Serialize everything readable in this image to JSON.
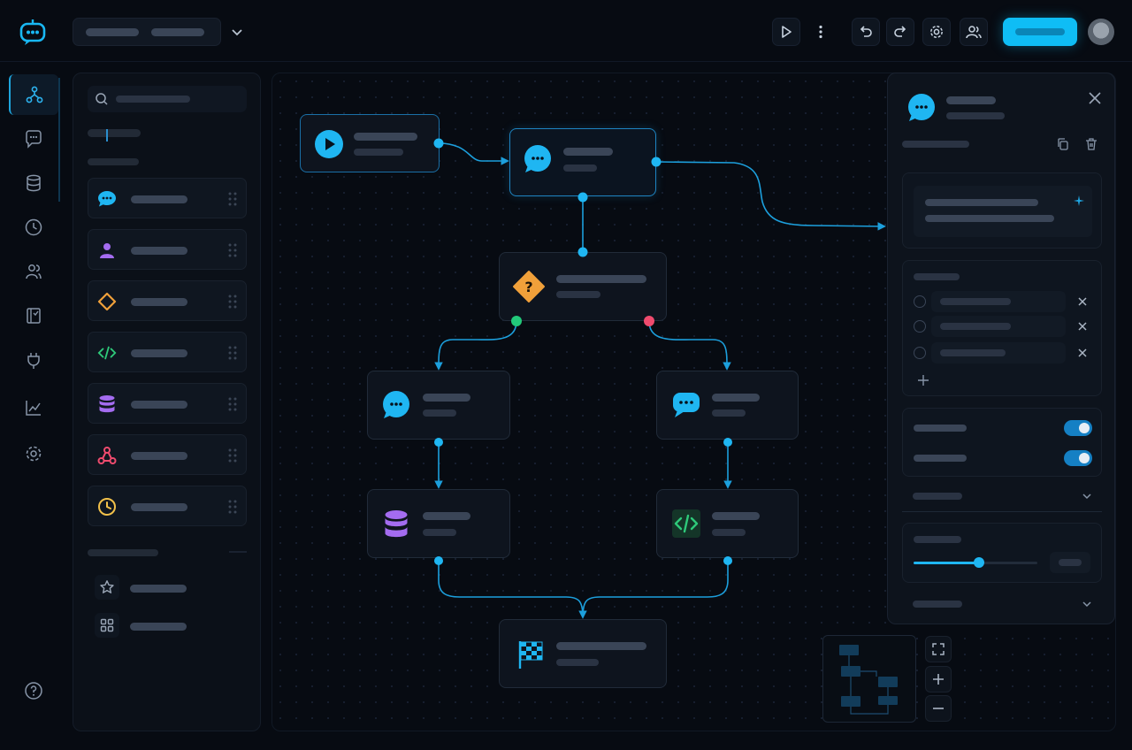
{
  "toolbar": {
    "run_icon": "play-icon",
    "more_icon": "vertical-dots-icon",
    "undo_icon": "undo-icon",
    "redo_icon": "redo-icon",
    "settings_icon": "gear-icon",
    "collaborators_icon": "users-icon",
    "accent": "#0fbdf5"
  },
  "rail": {
    "items": [
      "flow-icon",
      "chat-icon",
      "database-icon",
      "clock-icon",
      "users-icon",
      "book-icon",
      "plug-icon",
      "analytics-icon",
      "gear-icon",
      "help-icon"
    ],
    "active": "flow-icon"
  },
  "palette": {
    "blocks": [
      {
        "icon": "chat-bubble-icon",
        "color": "#1fb6f2"
      },
      {
        "icon": "person-icon",
        "color": "#a46cf0"
      },
      {
        "icon": "diamond-icon",
        "color": "#f0a03a"
      },
      {
        "icon": "code-icon",
        "color": "#2ec97a"
      },
      {
        "icon": "database-icon",
        "color": "#a46cf0"
      },
      {
        "icon": "webhook-icon",
        "color": "#ef4b6e"
      },
      {
        "icon": "clock-icon",
        "color": "#f2c14a"
      }
    ],
    "extras": [
      "star-icon",
      "grid-icon"
    ]
  },
  "canvas": {
    "nodes": [
      {
        "id": "start",
        "icon": "play-icon",
        "color": "#1fb6f2"
      },
      {
        "id": "message",
        "icon": "chat-bubble-icon",
        "color": "#1fb6f2",
        "selected": true
      },
      {
        "id": "condition",
        "icon": "question-diamond-icon",
        "color": "#f0a03a"
      },
      {
        "id": "reply-left",
        "icon": "chat-bubble-icon",
        "color": "#1fb6f2"
      },
      {
        "id": "reply-right",
        "icon": "chat-bubble-icon",
        "color": "#1fb6f2"
      },
      {
        "id": "database",
        "icon": "database-icon",
        "color": "#a46cf0"
      },
      {
        "id": "code",
        "icon": "code-icon",
        "color": "#2ec97a"
      },
      {
        "id": "end",
        "icon": "checkered-flag-icon",
        "color": "#1fb6f2"
      }
    ],
    "branch_true_color": "#22c97a",
    "branch_false_color": "#ef4b6e",
    "edge_color": "#1c9fdc"
  },
  "properties": {
    "header_icon": "chat-bubble-icon",
    "options_count": 3,
    "toggles": [
      true,
      true
    ],
    "slider_value": 0.53
  }
}
